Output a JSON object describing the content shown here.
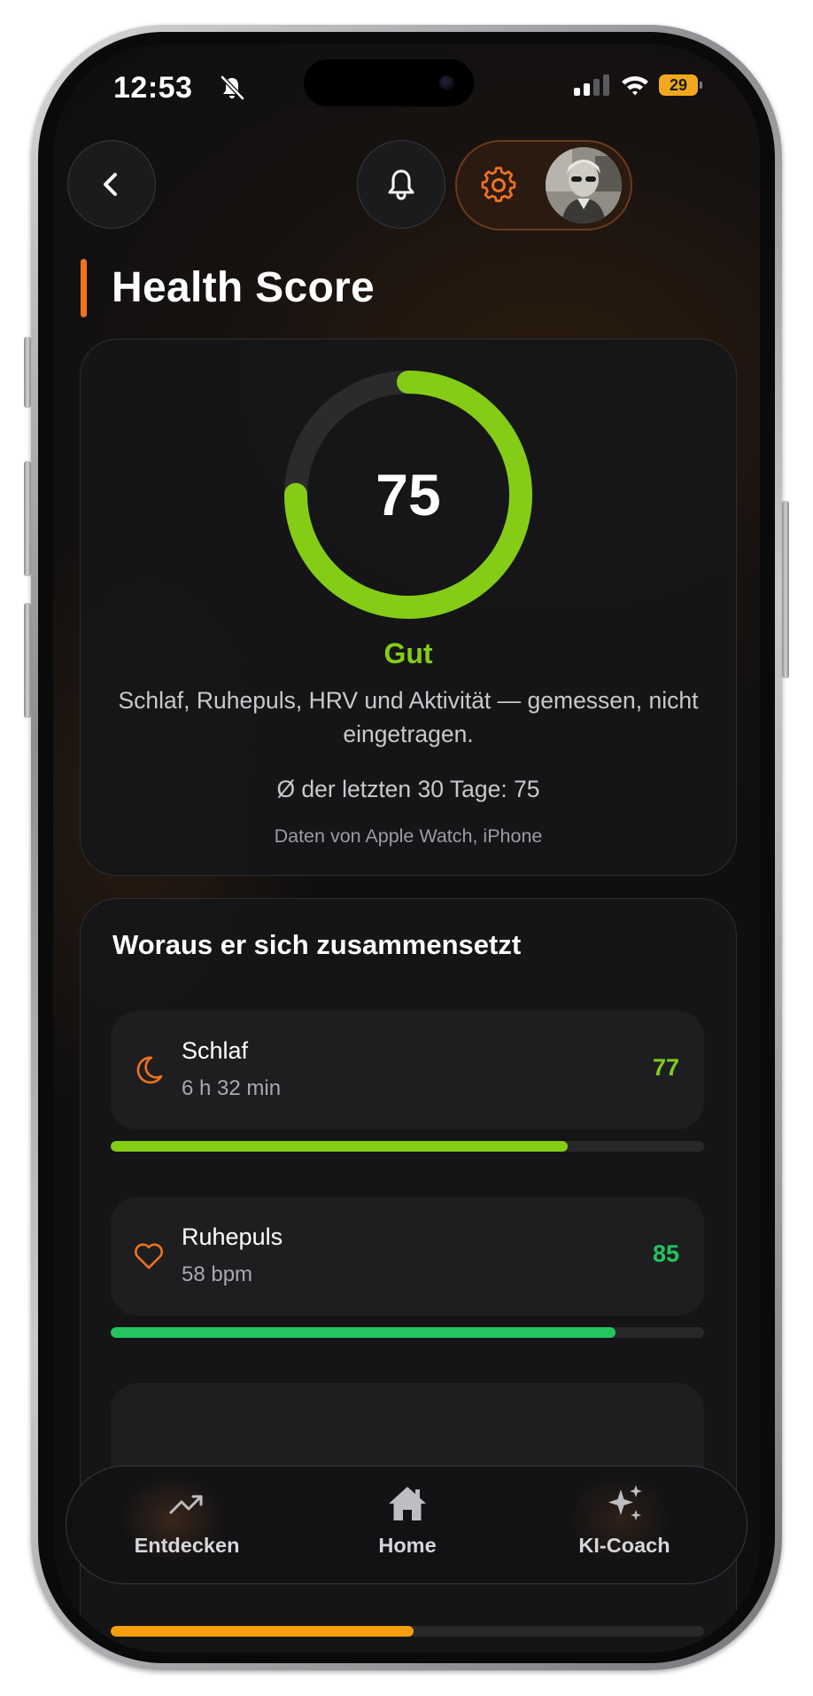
{
  "status_bar": {
    "time": "12:53",
    "battery": "29"
  },
  "header": {
    "title": "Health Score"
  },
  "score_card": {
    "score": "75",
    "score_fraction": 0.75,
    "rating": "Gut",
    "description": "Schlaf, Ruhepuls, HRV und Aktivität — gemessen, nicht eingetragen.",
    "average": "Ø der letzten 30 Tage: 75",
    "source": "Daten von Apple Watch, iPhone",
    "ring_color": "#84cc16"
  },
  "components": {
    "title": "Woraus er sich zusammensetzt",
    "items": [
      {
        "icon": "moon-icon",
        "name": "Schlaf",
        "detail": "6 h 32 min",
        "score": "77",
        "fraction": 0.77,
        "color": "#84cc16"
      },
      {
        "icon": "heart-icon",
        "name": "Ruhepuls",
        "detail": "58 bpm",
        "score": "85",
        "fraction": 0.85,
        "color": "#22c55e"
      },
      {
        "fraction": 0.51,
        "color": "#f59e0b"
      }
    ]
  },
  "tabbar": {
    "items": [
      {
        "label": "Entdecken",
        "icon": "trending-up-icon"
      },
      {
        "label": "Home",
        "icon": "home-icon"
      },
      {
        "label": "KI-Coach",
        "icon": "sparkles-icon"
      }
    ]
  },
  "colors": {
    "accent": "#f0731e",
    "good": "#84cc16",
    "green": "#22c55e",
    "amber": "#f59e0b"
  }
}
